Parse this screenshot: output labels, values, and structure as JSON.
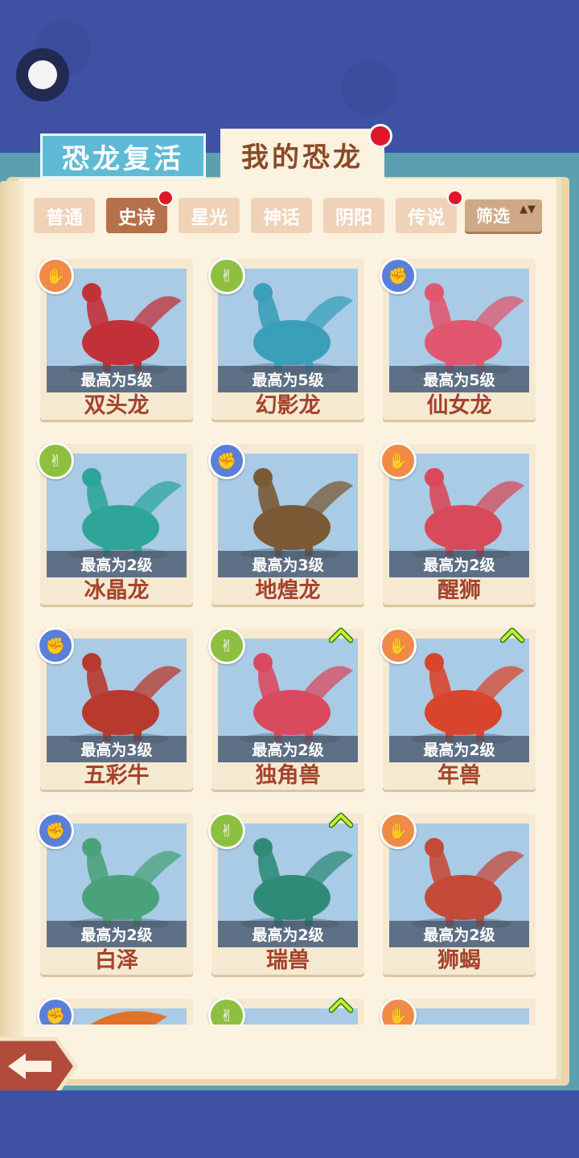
{
  "header": {
    "tabs": [
      {
        "label": "恐龙复活"
      },
      {
        "label": "我的恐龙"
      }
    ]
  },
  "filters": {
    "tabs": [
      {
        "label": "普通"
      },
      {
        "label": "史诗"
      },
      {
        "label": "星光"
      },
      {
        "label": "神话"
      },
      {
        "label": "阴阳"
      },
      {
        "label": "传说"
      }
    ],
    "selected": "史诗",
    "filter_label": "筛选",
    "filter_arrows": "▲▼"
  },
  "hand_glyphs": {
    "rock": "✊",
    "scissors": "✌",
    "paper": "✋"
  },
  "up_glyph": "⌃",
  "cards": [
    {
      "name": "双头龙",
      "level": "最高为5级",
      "type": "paper",
      "color": "#c2303a"
    },
    {
      "name": "幻影龙",
      "level": "最高为5级",
      "type": "scissors",
      "color": "#3a9fb8"
    },
    {
      "name": "仙女龙",
      "level": "最高为5级",
      "type": "rock",
      "color": "#e0576f"
    },
    {
      "name": "冰晶龙",
      "level": "最高为2级",
      "type": "scissors",
      "color": "#2fa59a"
    },
    {
      "name": "地煌龙",
      "level": "最高为3级",
      "type": "rock",
      "color": "#7a5a35"
    },
    {
      "name": "醒狮",
      "level": "最高为2级",
      "type": "paper",
      "color": "#d84a5a"
    },
    {
      "name": "五彩牛",
      "level": "最高为3级",
      "type": "rock",
      "color": "#b83a2e"
    },
    {
      "name": "独角兽",
      "level": "最高为2级",
      "type": "scissors",
      "color": "#d94a5e"
    },
    {
      "name": "年兽",
      "level": "最高为2级",
      "type": "paper",
      "color": "#d9452c"
    },
    {
      "name": "白泽",
      "level": "最高为2级",
      "type": "rock",
      "color": "#4aa27a"
    },
    {
      "name": "瑞兽",
      "level": "最高为2级",
      "type": "scissors",
      "color": "#2f8b78"
    },
    {
      "name": "狮蝎",
      "level": "最高为2级",
      "type": "paper",
      "color": "#c44a3a"
    },
    {
      "name": "",
      "level": "",
      "type": "rock",
      "color": "#e0732a"
    },
    {
      "name": "",
      "level": "",
      "type": "scissors",
      "color": "#a9cbe5"
    },
    {
      "name": "",
      "level": "",
      "type": "paper",
      "color": "#a9cbe5"
    }
  ],
  "upgrade_markers": [
    7,
    8,
    10,
    13
  ]
}
